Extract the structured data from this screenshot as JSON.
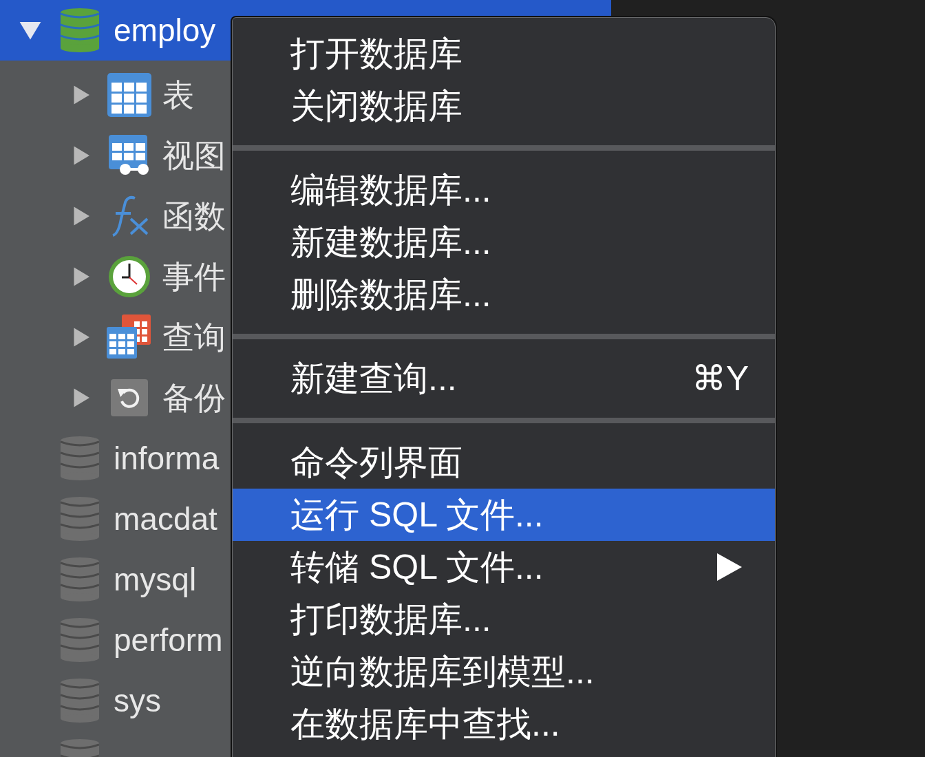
{
  "sidebar": {
    "databases": [
      {
        "name": "employ",
        "open": true,
        "selected": true,
        "expanded": true,
        "children": [
          {
            "label": "表",
            "kind": "table",
            "expanded": false
          },
          {
            "label": "视图",
            "kind": "view",
            "expanded": false
          },
          {
            "label": "函数",
            "kind": "function",
            "expanded": false
          },
          {
            "label": "事件",
            "kind": "event",
            "expanded": false
          },
          {
            "label": "查询",
            "kind": "query",
            "expanded": false
          },
          {
            "label": "备份",
            "kind": "backup",
            "expanded": false
          }
        ]
      },
      {
        "name": "informa",
        "open": false,
        "selected": false
      },
      {
        "name": "macdat",
        "open": false,
        "selected": false
      },
      {
        "name": "mysql",
        "open": false,
        "selected": false
      },
      {
        "name": "perform",
        "open": false,
        "selected": false
      },
      {
        "name": "sys",
        "open": false,
        "selected": false
      },
      {
        "open": false,
        "selected": false
      }
    ]
  },
  "context_menu": {
    "groups": [
      [
        {
          "label": "打开数据库",
          "selected": false
        },
        {
          "label": "关闭数据库",
          "selected": false
        }
      ],
      [
        {
          "label": "编辑数据库...",
          "selected": false
        },
        {
          "label": "新建数据库...",
          "selected": false
        },
        {
          "label": "删除数据库...",
          "selected": false
        }
      ],
      [
        {
          "label": "新建查询...",
          "shortcut": "⌘Y",
          "selected": false
        }
      ],
      [
        {
          "label": "命令列界面",
          "selected": false
        },
        {
          "label": "运行 SQL 文件...",
          "selected": true
        },
        {
          "label": "转储 SQL 文件...",
          "submenu": true,
          "selected": false
        },
        {
          "label": "打印数据库...",
          "selected": false
        },
        {
          "label": "逆向数据库到模型...",
          "selected": false
        },
        {
          "label": "在数据库中查找...",
          "selected": false
        }
      ]
    ]
  }
}
